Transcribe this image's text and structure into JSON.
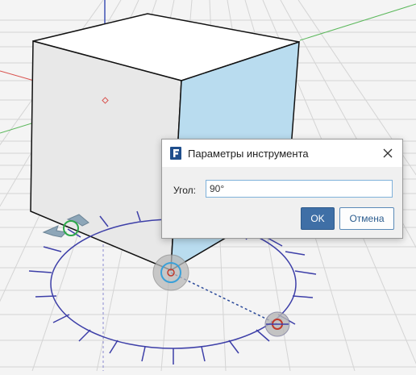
{
  "dialog": {
    "title": "Параметры инструмента",
    "angle_label": "Угол:",
    "angle_value": "90°",
    "ok_label": "OK",
    "cancel_label": "Отмена"
  },
  "icons": {
    "app": "formit-logo-icon",
    "close": "close-icon"
  },
  "colors": {
    "accent": "#3f6fa6",
    "protractor": "#3d3fa8",
    "axis_x": "#d9534f",
    "axis_y": "#5cb85c",
    "axis_z": "#3f51b5",
    "face_right": "#b9dcef"
  }
}
